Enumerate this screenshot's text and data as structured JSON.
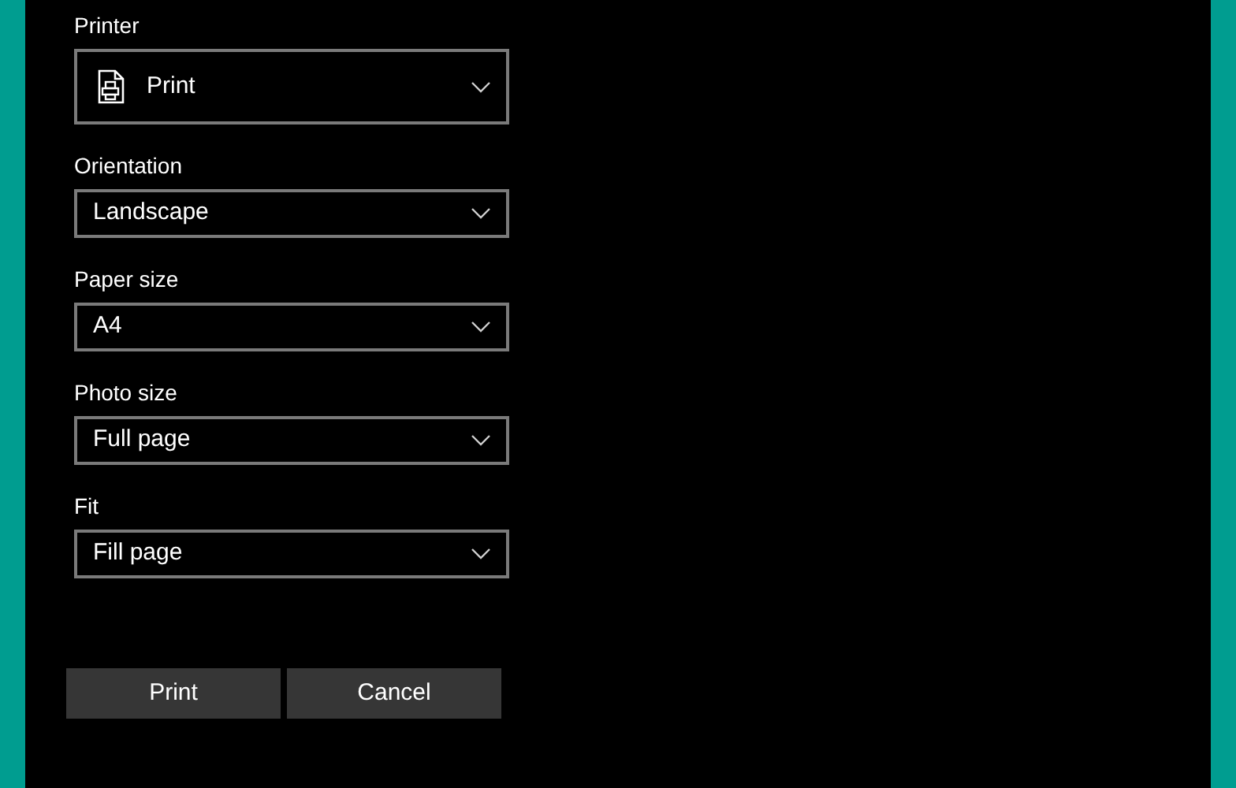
{
  "fields": [
    {
      "label": "Printer",
      "value": "Print",
      "kind": "printer"
    },
    {
      "label": "Orientation",
      "value": "Landscape",
      "kind": "select"
    },
    {
      "label": "Paper size",
      "value": "A4",
      "kind": "select"
    },
    {
      "label": "Photo size",
      "value": "Full page",
      "kind": "select"
    },
    {
      "label": "Fit",
      "value": "Fill page",
      "kind": "select"
    }
  ],
  "buttons": [
    "Print",
    "Cancel"
  ]
}
